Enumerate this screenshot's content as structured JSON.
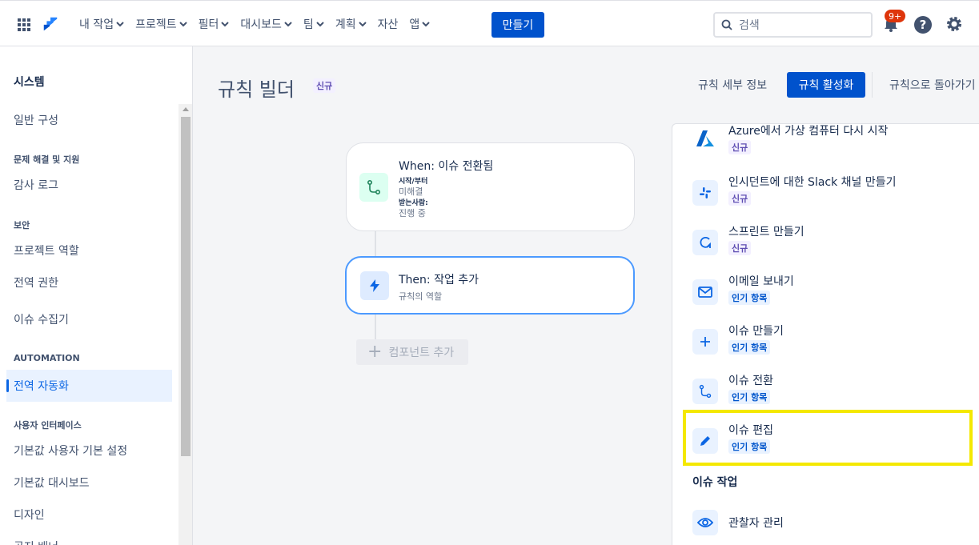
{
  "topnav": {
    "items": [
      {
        "label": "내 작업",
        "dropdown": true
      },
      {
        "label": "프로젝트",
        "dropdown": true
      },
      {
        "label": "필터",
        "dropdown": true
      },
      {
        "label": "대시보드",
        "dropdown": true
      },
      {
        "label": "팀",
        "dropdown": true
      },
      {
        "label": "계획",
        "dropdown": true
      },
      {
        "label": "자산",
        "dropdown": false
      },
      {
        "label": "앱",
        "dropdown": true
      }
    ],
    "create_label": "만들기",
    "search_placeholder": "검색",
    "notification_count": "9+",
    "help_glyph": "?",
    "accent": "#0052cc"
  },
  "sidebar": {
    "title": "시스템",
    "entries": [
      {
        "kind": "item",
        "label": "일반 구성"
      },
      {
        "kind": "section",
        "label": "문제 해결 및 지원"
      },
      {
        "kind": "item",
        "label": "감사 로그"
      },
      {
        "kind": "section",
        "label": "보안"
      },
      {
        "kind": "item",
        "label": "프로젝트 역할"
      },
      {
        "kind": "item",
        "label": "전역 권한"
      },
      {
        "kind": "item",
        "label": "이슈 수집기"
      },
      {
        "kind": "section",
        "label": "AUTOMATION"
      },
      {
        "kind": "item",
        "label": "전역 자동화",
        "active": true
      },
      {
        "kind": "section",
        "label": "사용자 인터페이스"
      },
      {
        "kind": "item",
        "label": "기본값 사용자 기본 설정"
      },
      {
        "kind": "item",
        "label": "기본값 대시보드"
      },
      {
        "kind": "item",
        "label": "디자인"
      },
      {
        "kind": "item",
        "label": "공지 배너"
      }
    ]
  },
  "header": {
    "title": "규칙 빌더",
    "title_badge": "신규",
    "details_link": "규칙 세부 정보",
    "enable_button": "규칙 활성화",
    "back_link": "규칙으로 돌아가기"
  },
  "rule": {
    "trigger": {
      "title": "When: 이슈 전환됨",
      "from_label": "시작/부터",
      "from_value": "미해결",
      "to_label": "받는사람:",
      "to_value": "진행 중"
    },
    "action": {
      "title": "Then: 작업 추가",
      "subtitle": "규칙의 역할"
    },
    "add_component": "컴포넌트 추가"
  },
  "panel": {
    "items": [
      {
        "label": "Azure에서 가상 컴퓨터 다시 시작",
        "badge": "신규",
        "badge_kind": "new",
        "icon": "azure-icon"
      },
      {
        "label": "인시던트에 대한 Slack 채널 만들기",
        "badge": "신규",
        "badge_kind": "new",
        "icon": "slack-icon"
      },
      {
        "label": "스프린트 만들기",
        "badge": "신규",
        "badge_kind": "new",
        "icon": "sprint-icon"
      },
      {
        "label": "이메일 보내기",
        "badge": "인기 항목",
        "badge_kind": "pop",
        "icon": "mail-icon"
      },
      {
        "label": "이슈 만들기",
        "badge": "인기 항목",
        "badge_kind": "pop",
        "icon": "plus-icon"
      },
      {
        "label": "이슈 전환",
        "badge": "인기 항목",
        "badge_kind": "pop",
        "icon": "transition-icon"
      },
      {
        "label": "이슈 편집",
        "badge": "인기 항목",
        "badge_kind": "pop",
        "icon": "pencil-icon",
        "highlighted": true
      }
    ],
    "section_title": "이슈 작업",
    "section_items": [
      {
        "label": "관찰자 관리",
        "icon": "eye-icon"
      }
    ],
    "highlight_color": "#f4e800"
  }
}
